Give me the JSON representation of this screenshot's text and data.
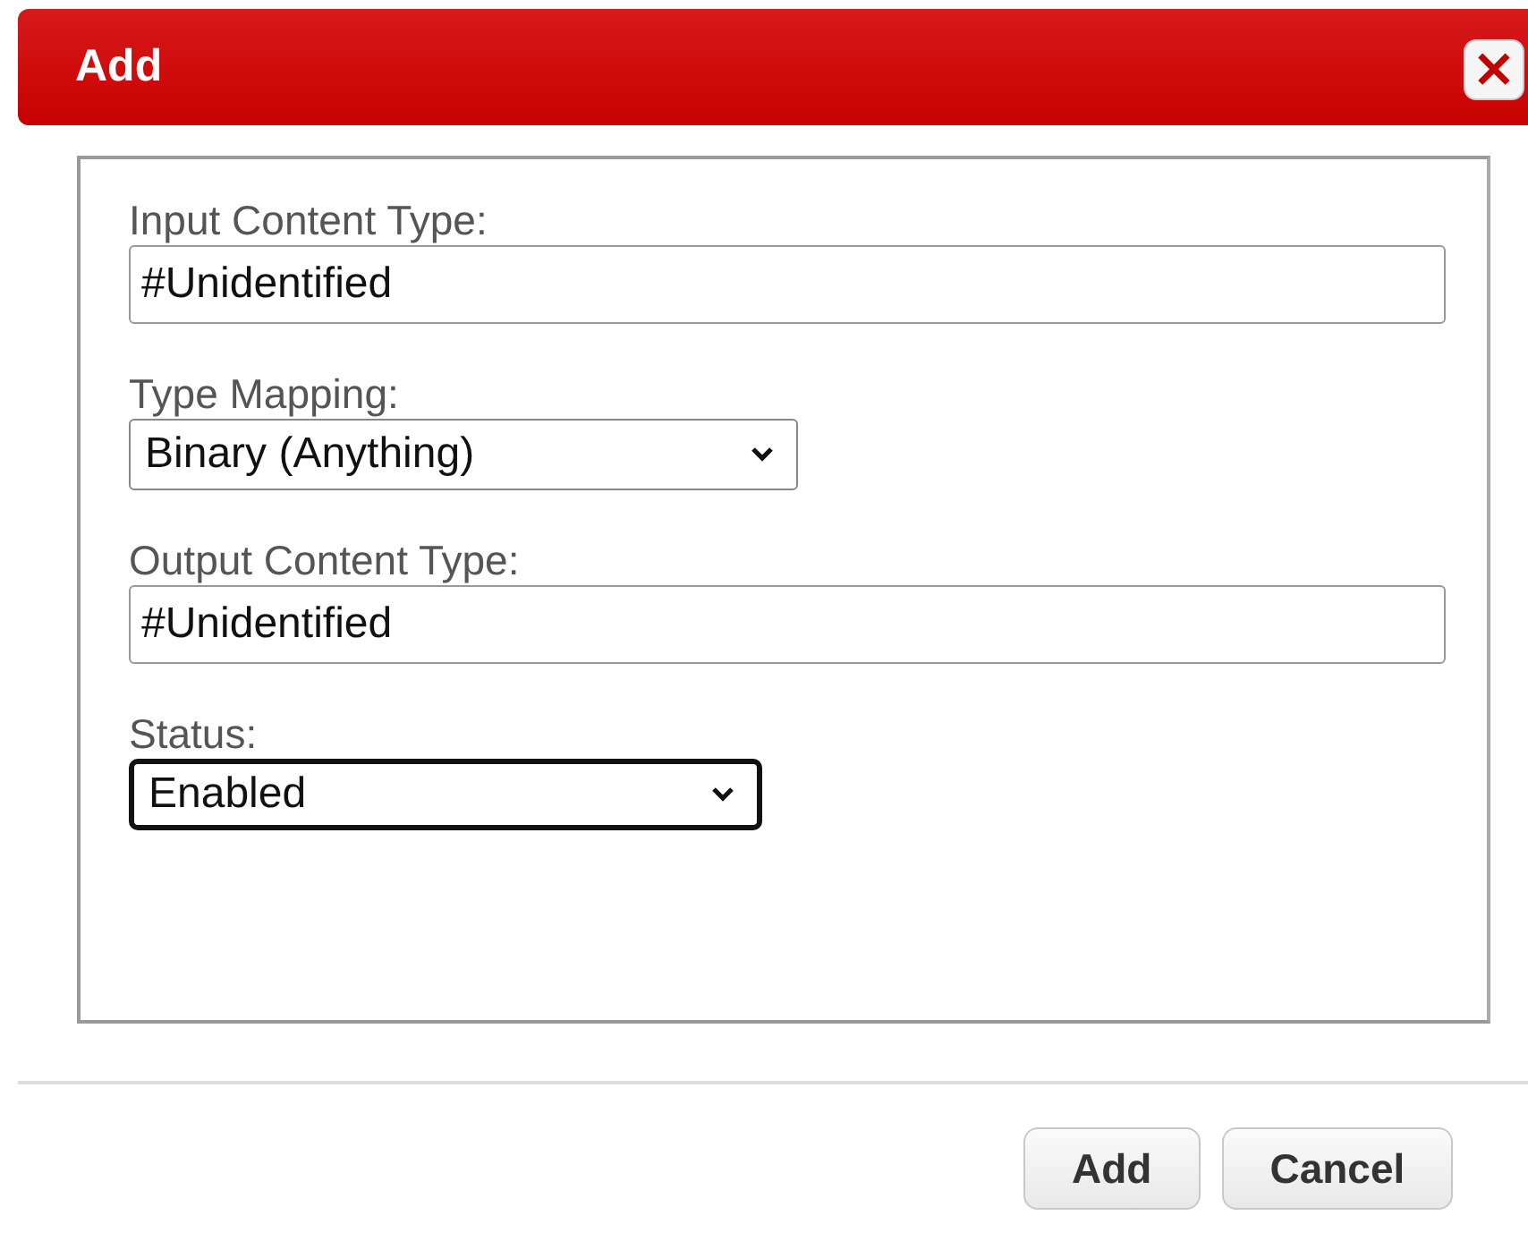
{
  "dialog": {
    "title": "Add",
    "close_icon": "×"
  },
  "fields": [
    {
      "kind": "text",
      "label": "Input Content Type:",
      "value": "#Unidentified",
      "focused": false
    },
    {
      "kind": "select",
      "label": "Type Mapping:",
      "value": "Binary (Anything)",
      "focused": false
    },
    {
      "kind": "text",
      "label": "Output Content Type:",
      "value": "#Unidentified",
      "focused": false
    },
    {
      "kind": "select",
      "label": "Status:",
      "value": "Enabled",
      "focused": true
    }
  ],
  "buttons": [
    "Add",
    "Cancel"
  ]
}
